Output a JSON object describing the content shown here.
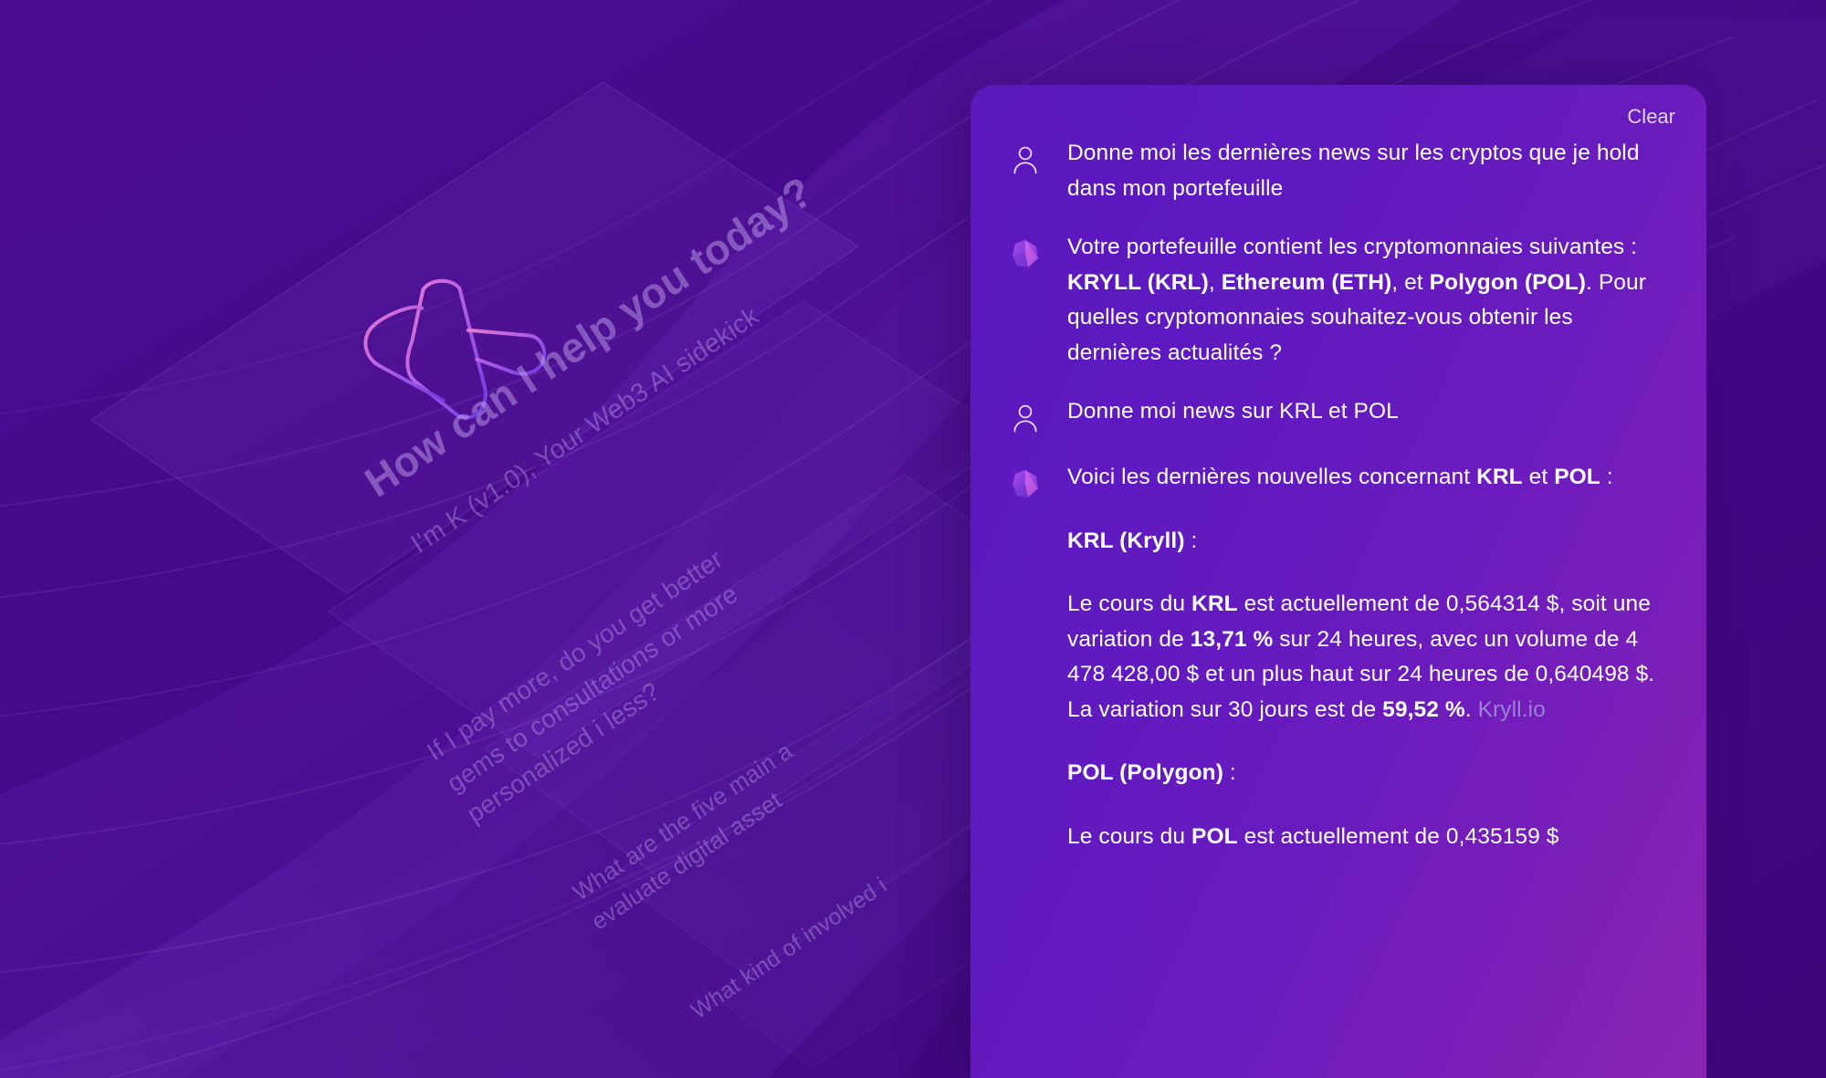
{
  "background": {
    "base_color": "#450989",
    "accent_color": "#8a24b4",
    "logo_icon": "kryll-logo-icon"
  },
  "hero": {
    "title": "How can I help you today?",
    "subtitle": "I'm K (v1.0), Your Web3 AI sidekick",
    "suggestion_cards": [
      "If I pay more, do you get better gems to consultations or more personalized i less?",
      "What are the five main a evaluate digital asset",
      "What kind of involved i"
    ]
  },
  "chat": {
    "clear_label": "Clear",
    "messages": [
      {
        "role": "user",
        "avatar_icon": "user-avatar-icon",
        "text": "Donne moi les dernières news sur les cryptos que je hold dans mon portefeuille"
      },
      {
        "role": "assistant",
        "avatar_icon": "gem-avatar-icon",
        "paragraphs": [
          {
            "segments": [
              {
                "t": "Votre portefeuille contient les cryptomonnaies suivantes : ",
                "bold": false
              },
              {
                "t": "KRYLL (KRL)",
                "bold": true
              },
              {
                "t": ", ",
                "bold": false
              },
              {
                "t": "Ethereum (ETH)",
                "bold": true
              },
              {
                "t": ", et ",
                "bold": false
              },
              {
                "t": "Polygon (POL)",
                "bold": true
              },
              {
                "t": ". Pour quelles cryptomonnaies souhaitez-vous obtenir les dernières actualités ?",
                "bold": false
              }
            ]
          }
        ]
      },
      {
        "role": "user",
        "avatar_icon": "user-avatar-icon",
        "text": "Donne moi news sur KRL et POL"
      },
      {
        "role": "assistant",
        "avatar_icon": "gem-avatar-icon",
        "paragraphs": [
          {
            "segments": [
              {
                "t": "Voici les dernières nouvelles concernant ",
                "bold": false
              },
              {
                "t": "KRL",
                "bold": true
              },
              {
                "t": " et ",
                "bold": false
              },
              {
                "t": "POL",
                "bold": true
              },
              {
                "t": " :",
                "bold": false
              }
            ]
          },
          {
            "segments": [
              {
                "t": "KRL (Kryll)",
                "bold": true
              },
              {
                "t": " :",
                "bold": false
              }
            ]
          },
          {
            "segments": [
              {
                "t": "Le cours du ",
                "bold": false
              },
              {
                "t": "KRL",
                "bold": true
              },
              {
                "t": " est actuellement de 0,564314 $, soit une variation de ",
                "bold": false
              },
              {
                "t": "13,71 %",
                "bold": true
              },
              {
                "t": " sur 24 heures, avec un volume de 4 478 428,00 $ et un plus haut sur 24 heures de 0,640498 $. La variation sur 30 jours est de ",
                "bold": false
              },
              {
                "t": "59,52 %",
                "bold": true
              },
              {
                "t": ". ",
                "bold": false
              },
              {
                "t": "Kryll.io",
                "bold": false,
                "link": true
              }
            ]
          },
          {
            "segments": [
              {
                "t": "POL (Polygon)",
                "bold": true
              },
              {
                "t": " :",
                "bold": false
              }
            ]
          },
          {
            "segments": [
              {
                "t": "Le cours du ",
                "bold": false
              },
              {
                "t": "POL",
                "bold": true
              },
              {
                "t": " est actuellement de 0,435159 $",
                "bold": false
              }
            ]
          }
        ]
      }
    ]
  },
  "colors": {
    "panel_gradient_start": "#5b18bd",
    "panel_gradient_end": "#8a24b4",
    "page_background": "#450989",
    "link": "#9d82d8",
    "text": "#ffffff",
    "clear_text": "#ded3f2"
  }
}
